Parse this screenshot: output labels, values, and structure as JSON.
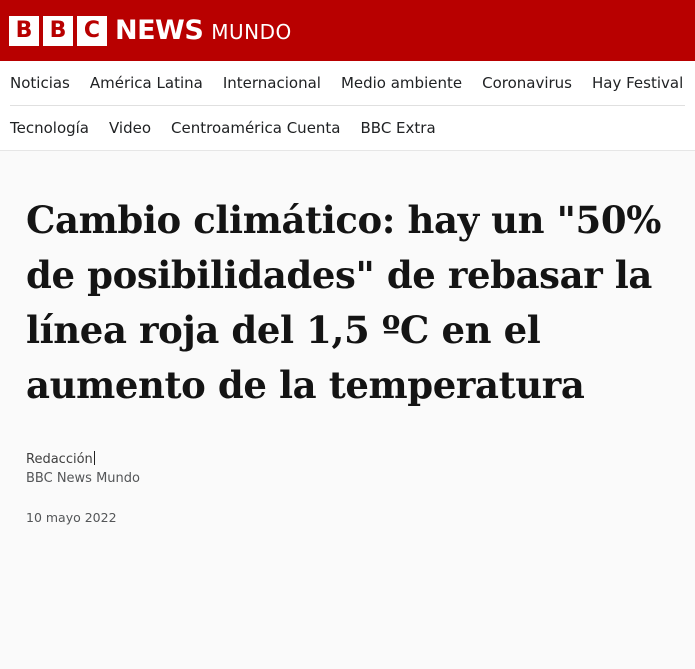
{
  "brand": {
    "blocks": [
      "B",
      "B",
      "C"
    ],
    "news": "NEWS",
    "edition": "MUNDO",
    "color": "#b80000"
  },
  "nav": {
    "row1": [
      "Noticias",
      "América Latina",
      "Internacional",
      "Medio ambiente",
      "Coronavirus",
      "Hay Festival"
    ],
    "row2": [
      "Tecnología",
      "Video",
      "Centroamérica Cuenta",
      "BBC Extra"
    ]
  },
  "article": {
    "headline": "Cambio climático: hay un \"50% de posibilidades\" de rebasar la línea roja del 1,5 ºC en el aumento de la temperatura",
    "author": "Redacción",
    "source": "BBC News Mundo",
    "date": "10 mayo 2022"
  }
}
